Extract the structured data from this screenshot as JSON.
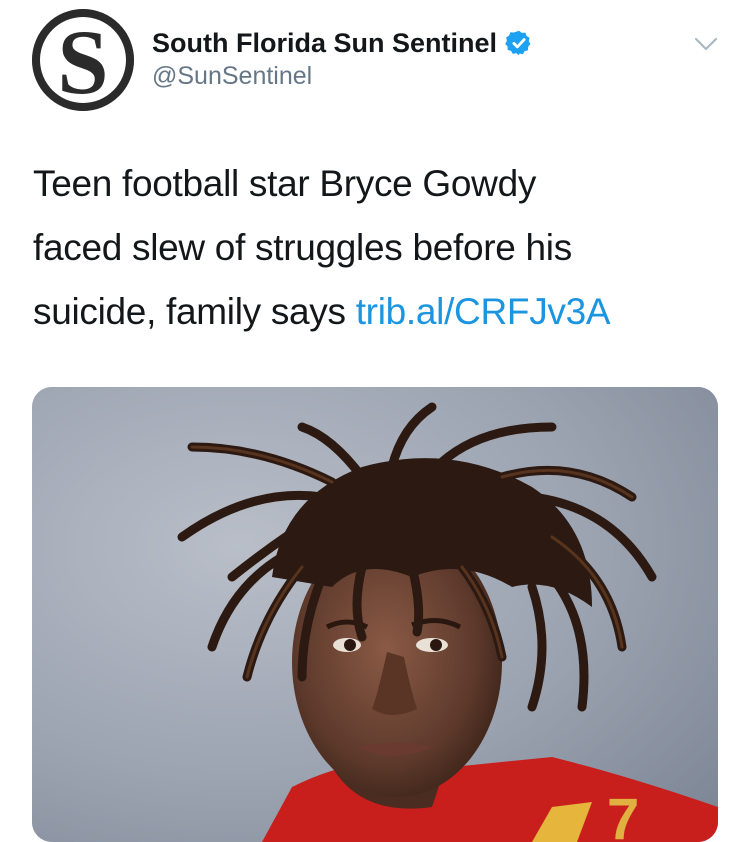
{
  "account": {
    "display_name": "South Florida Sun Sentinel",
    "handle": "@SunSentinel",
    "verified": true,
    "avatar_letter": "S",
    "avatar_icon": "sun-sentinel-logo"
  },
  "tweet": {
    "text_lines": [
      "Teen football star Bryce Gowdy",
      "faced slew of struggles before his",
      "suicide, family says"
    ],
    "link": "trib.al/CRFJv3A"
  },
  "media": {
    "jersey_number": "7"
  },
  "icons": {
    "verified": "verified-badge-icon",
    "more": "chevron-down-icon"
  },
  "colors": {
    "text": "#14171a",
    "secondary": "#657786",
    "link": "#1b95e0",
    "verified": "#1da1f2"
  }
}
